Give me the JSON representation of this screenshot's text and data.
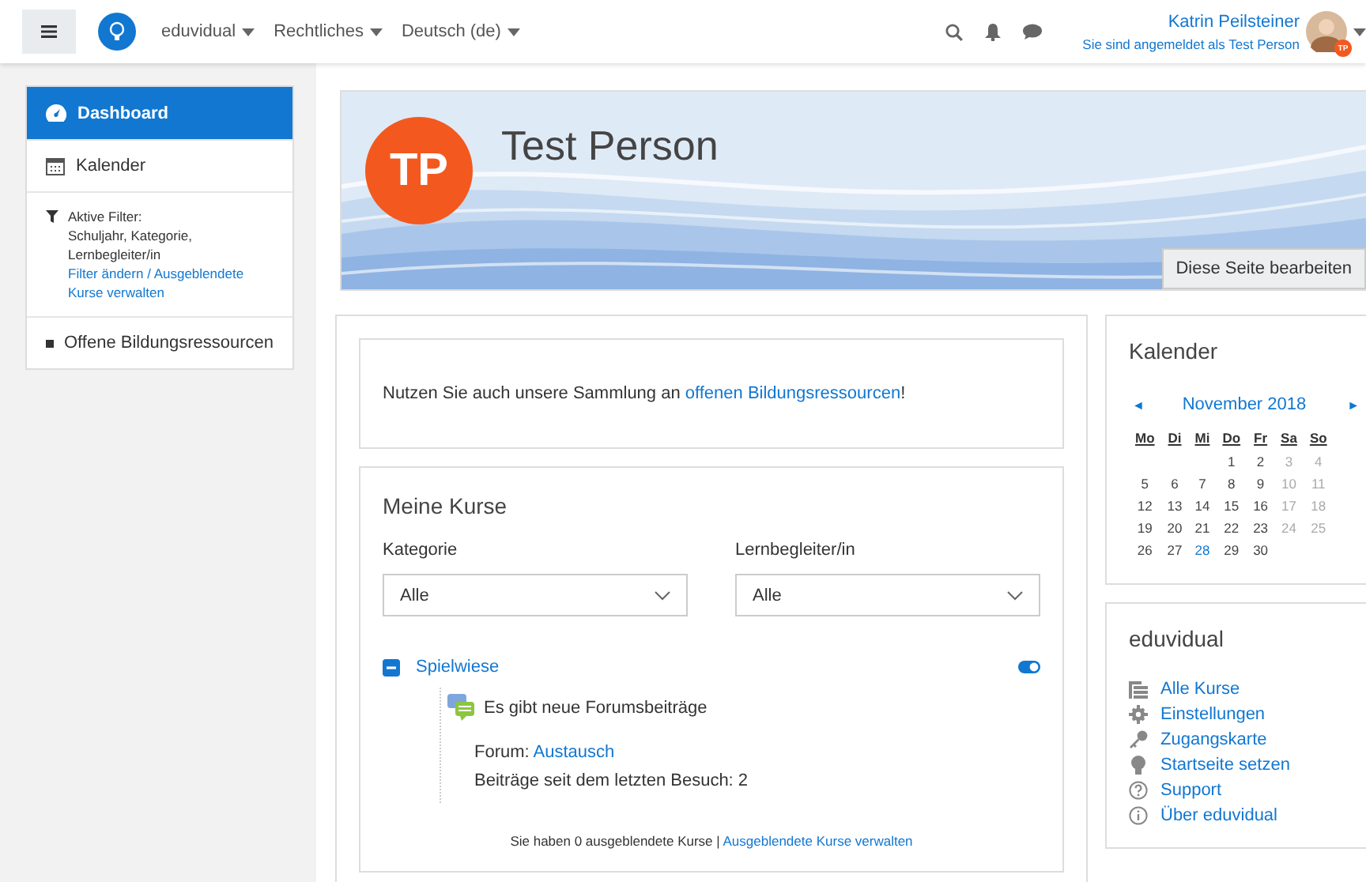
{
  "navbar": {
    "menus": [
      "eduvidual",
      "Rechtliches",
      "Deutsch (de)"
    ],
    "user": {
      "name": "Katrin Peilsteiner",
      "subtitle": "Sie sind angemeldet als Test Person",
      "badge": "TP"
    }
  },
  "sidebar": {
    "items": [
      {
        "kind": "link",
        "label": "Dashboard",
        "selected": true
      },
      {
        "kind": "link",
        "label": "Kalender",
        "selected": false
      },
      {
        "kind": "filter",
        "title": "Aktive Filter:",
        "text": "Schuljahr, Kategorie, Lernbegleiter/in",
        "link": "Filter ändern / Ausgeblendete Kurse verwalten"
      },
      {
        "kind": "link",
        "label": "Offene Bildungsressourcen",
        "selected": false
      }
    ]
  },
  "header": {
    "initials": "TP",
    "name": "Test Person",
    "button": "Diese Seite bearbeiten"
  },
  "notice": {
    "text": "Nutzen Sie auch unsere Sammlung an ",
    "link": "offenen Bildungsressourcen",
    "suffix": "!"
  },
  "my_courses": {
    "title": "Meine Kurse",
    "filters": [
      {
        "label": "Kategorie",
        "value": "Alle"
      },
      {
        "label": "Lernbegleiter/in",
        "value": "Alle"
      }
    ],
    "courses": [
      {
        "name": "Spielwiese",
        "expanded": true,
        "on": true,
        "news": "Es gibt neue Forumsbeiträge",
        "forum_label": "Forum:",
        "forum": "Austausch",
        "posts": "Beiträge seit dem letzten Besuch: 2"
      }
    ],
    "footer": {
      "text": "Sie haben 0 ausgeblendete Kurse |",
      "link": "Ausgeblendete Kurse verwalten"
    }
  },
  "calendar": {
    "title": "Kalender",
    "prev": "◄",
    "month": "November 2018",
    "next": "►",
    "weekdays": [
      "Mo",
      "Di",
      "Mi",
      "Do",
      "Fr",
      "Sa",
      "So"
    ],
    "weeks": [
      [
        {
          "d": "1",
          "muted": false,
          "today": false
        },
        {
          "d": "2",
          "muted": false,
          "today": false
        },
        {
          "d": "3",
          "muted": true,
          "today": false
        },
        {
          "d": "4",
          "muted": true,
          "today": false
        }
      ],
      [
        {
          "d": "5",
          "muted": false,
          "today": false
        },
        {
          "d": "6",
          "muted": false,
          "today": false
        },
        {
          "d": "7",
          "muted": false,
          "today": false
        },
        {
          "d": "8",
          "muted": false,
          "today": false
        },
        {
          "d": "9",
          "muted": false,
          "today": false
        },
        {
          "d": "10",
          "muted": true,
          "today": false
        },
        {
          "d": "11",
          "muted": true,
          "today": false
        }
      ],
      [
        {
          "d": "12",
          "muted": false,
          "today": false
        },
        {
          "d": "13",
          "muted": false,
          "today": false
        },
        {
          "d": "14",
          "muted": false,
          "today": false
        },
        {
          "d": "15",
          "muted": false,
          "today": false
        },
        {
          "d": "16",
          "muted": false,
          "today": false
        },
        {
          "d": "17",
          "muted": true,
          "today": false
        },
        {
          "d": "18",
          "muted": true,
          "today": false
        }
      ],
      [
        {
          "d": "19",
          "muted": false,
          "today": false
        },
        {
          "d": "20",
          "muted": false,
          "today": false
        },
        {
          "d": "21",
          "muted": false,
          "today": false
        },
        {
          "d": "22",
          "muted": false,
          "today": false
        },
        {
          "d": "23",
          "muted": false,
          "today": false
        },
        {
          "d": "24",
          "muted": true,
          "today": false
        },
        {
          "d": "25",
          "muted": true,
          "today": false
        }
      ],
      [
        {
          "d": "26",
          "muted": false,
          "today": false
        },
        {
          "d": "27",
          "muted": false,
          "today": false
        },
        {
          "d": "28",
          "muted": false,
          "today": true
        },
        {
          "d": "29",
          "muted": false,
          "today": false
        },
        {
          "d": "30",
          "muted": false,
          "today": false
        }
      ]
    ]
  },
  "eduvidual": {
    "title": "eduvidual",
    "links": [
      {
        "label": "Alle Kurse"
      },
      {
        "label": "Einstellungen"
      },
      {
        "label": "Zugangskarte"
      },
      {
        "label": "Startseite setzen"
      },
      {
        "label": "Support"
      },
      {
        "label": "Über eduvidual"
      }
    ]
  }
}
